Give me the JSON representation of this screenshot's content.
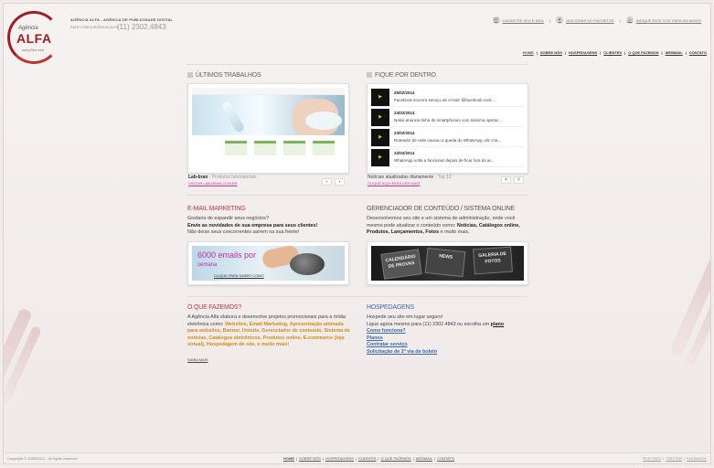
{
  "brand": {
    "logo_top": "Agência",
    "logo_main": "ALFA",
    "logo_sub": "soluções web",
    "company_line": "AGÊNCIA ALFA - AGÊNCIA DE PUBLICIDADE DIGITAL",
    "phone_label": "FALE COM A AGÊNCIA ALFA",
    "phone": "(11) 2302.4843"
  },
  "header_links": [
    {
      "icon": "envelope",
      "label": "CADASTRE SEU E-MAIL"
    },
    {
      "icon": "heart",
      "label": "ADICIONAR AO FAVORITOS"
    },
    {
      "icon": "share",
      "label": "INDIQUE ESTE SITE PARA UM AMIGO"
    }
  ],
  "nav": [
    "HOME",
    "SOBRE NÓS",
    "HOSPEDAGENS",
    "CLIENTES",
    "O QUE FAZEMOS",
    "WEBMAIL",
    "CONTATO"
  ],
  "works": {
    "title": "ÚLTIMOS TRABALHOS",
    "client": "Lab-bran",
    "desc": "- Produtos laboratoriais",
    "link": "VISITAR LAB-BRAN.COM.BR",
    "prev": "‹",
    "next": "›"
  },
  "news": {
    "title": "FIQUE POR DENTRO",
    "items": [
      {
        "date": "25/02/2014",
        "title": "Facebook encerra serviço de e-mail '@facebook.com'..."
      },
      {
        "date": "24/02/2014",
        "title": "Nokia anuncia linha de smartphones com sistema operac..."
      },
      {
        "date": "23/02/2014",
        "title": "Roteador de rede causou a queda do WhatsApp, diz cria..."
      },
      {
        "date": "22/02/2014",
        "title": "WhatsApp volta a funcionar depois de ficar fora do ar..."
      }
    ],
    "footer_text": "Notícias atualizadas diariamente",
    "footer_sub": "- Top 10",
    "link": "CLIQUE AQUI PARA VER MAIS",
    "up": "˄",
    "down": "˅"
  },
  "email_mkt": {
    "title": "E-MAIL MARKETING",
    "line1": "Gostaria de expandir seus negócios?",
    "line2": "Envie as novidades de sua empresa para seus clientes!",
    "line3": "Não deixe seus concorrentes saírem na sua frente!",
    "banner_big": "6000 emails por",
    "banner_small": "semana",
    "banner_cta": "CLIQUE PARA SABER COMO"
  },
  "cms": {
    "title": "GERENCIADOR DE CONTEÚDO / SISTEMA ONLINE",
    "text_a": "Desenvolvemos seu site e um sistema de administração, onde você mesmo pode atualizar o conteúdo como: ",
    "text_b": "Notícias, Catálogos online, Produtos, Lançamentos, Fotos",
    "text_c": " e muito mais.",
    "card1": "CALENDÁRIO DE PROVAS",
    "card2": "GALERIA DE FOTOS",
    "card3": "NEWS"
  },
  "what": {
    "title": "O QUE FAZEMOS?",
    "intro": "A Agência Alfa elabora e desenvolve projetos promocionais para a mídia eletrônica como: ",
    "services": "Websites, Email Marketing, Apresentação animada para websites, Banner, Hotsite, Gerenciador de conteúdo, Sistema de notícias, Catálogos eletrônicos, Produtos online, E-commerce (loja virtual), Hospedagem de site, e muito mais!",
    "link": "SAIBA MAIS"
  },
  "hosting": {
    "title": "HOSPEDAGENS",
    "line1": "Hospede seu site em lugar seguro!",
    "line2": "Ligue agora mesmo para (11) 2302.4843 ou escolha um ",
    "plano": "plano",
    "links": [
      "Como funciona?",
      "Planos",
      "Contratar serviço",
      "Solicitação de 2ª via de boleto"
    ]
  },
  "footer": {
    "copyright": "Copyright © 2005/2012 - All rights reserved",
    "nav": [
      "HOME",
      "SOBRE NÓS",
      "HOSPEDAGENS",
      "CLIENTES",
      "O QUE FAZEMOS",
      "WEBMAIL",
      "CONTATO"
    ],
    "right": [
      "RSS FEED",
      "TWITTER",
      "FACEBOOK"
    ]
  }
}
